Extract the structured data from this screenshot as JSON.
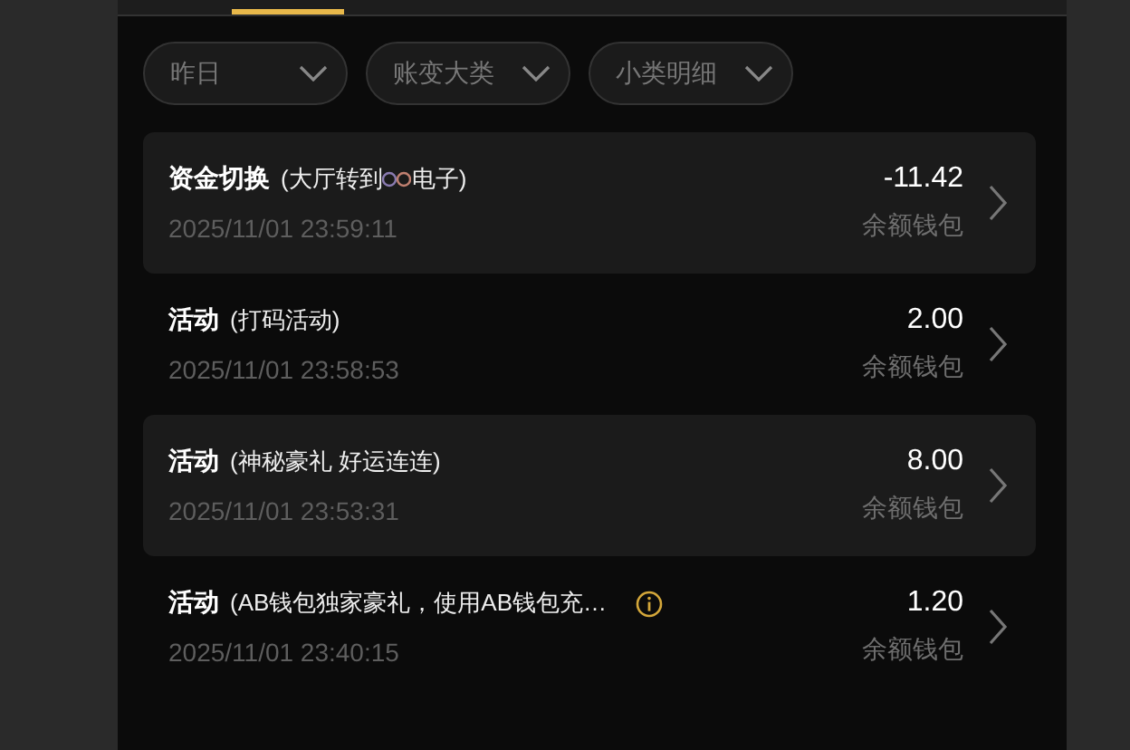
{
  "filters": [
    {
      "label": "昨日"
    },
    {
      "label": "账变大类"
    },
    {
      "label": "小类明细"
    }
  ],
  "records": [
    {
      "title": "资金切换",
      "detail": [
        "(大厅转到",
        "电子)"
      ],
      "time": "2025/11/01 23:59:11",
      "amount": "-11.42",
      "wallet": "余额钱包",
      "info": false
    },
    {
      "title": "活动",
      "detail": [
        "(打码活动)"
      ],
      "time": "2025/11/01 23:58:53",
      "amount": "2.00",
      "wallet": "余额钱包",
      "info": false
    },
    {
      "title": "活动",
      "detail": [
        "(神秘豪礼 好运连连)"
      ],
      "time": "2025/11/01 23:53:31",
      "amount": "8.00",
      "wallet": "余额钱包",
      "info": false
    },
    {
      "title": "活动",
      "detail": [
        "(AB钱包独家豪礼，使用AB钱包充…"
      ],
      "time": "2025/11/01 23:40:15",
      "amount": "1.20",
      "wallet": "余额钱包",
      "info": true
    }
  ]
}
